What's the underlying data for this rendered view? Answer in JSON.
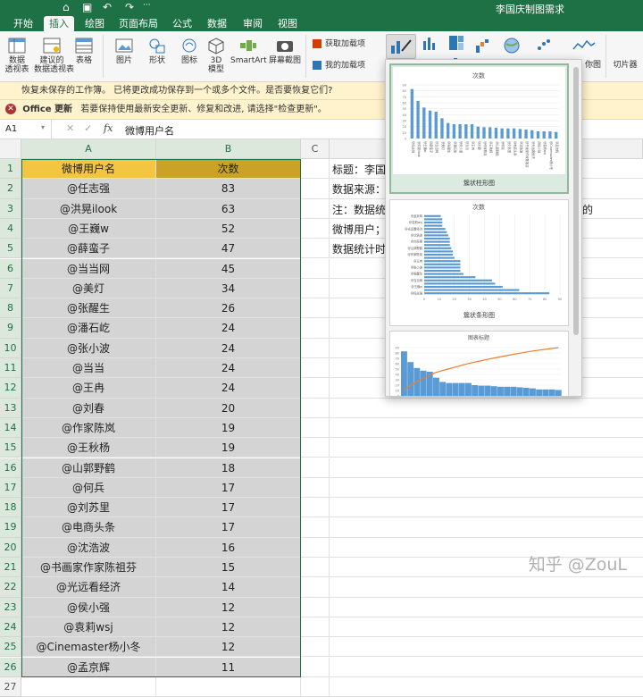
{
  "window": {
    "title": "李国庆制图需求"
  },
  "tabs": [
    "开始",
    "插入",
    "绘图",
    "页面布局",
    "公式",
    "数据",
    "审阅",
    "视图"
  ],
  "ribbon": {
    "pivot_table": "数据\n透视表",
    "recommended_pivot": "建议的\n数据透视表",
    "table": "表格",
    "pictures": "图片",
    "shapes": "形状",
    "icons": "图标",
    "model_3d": "3D\n模型",
    "smartart": "SmartArt",
    "screenshot": "屏幕截图",
    "get_addins": "获取加载项",
    "my_addins": "我的加载项",
    "map": "你图",
    "slicer": "切片器"
  },
  "messages": {
    "unsaved": "恢复未保存的工作簿。 已将更改成功保存到一个或多个文件。是否要恢复它们?",
    "update_label": "Office 更新",
    "update_text": "若要保持使用最新安全更新、修复和改进, 请选择\"检查更新\"。"
  },
  "formula_bar": {
    "name_box": "A1",
    "fx": "fx",
    "content": "微博用户名"
  },
  "columns": [
    "A",
    "B",
    "C"
  ],
  "headers": {
    "user": "微博用户名",
    "count": "次数"
  },
  "rows": [
    {
      "user": "@任志强",
      "count": "83"
    },
    {
      "user": "@洪晃ilook",
      "count": "63"
    },
    {
      "user": "@王巍w",
      "count": "52"
    },
    {
      "user": "@薛蛮子",
      "count": "47"
    },
    {
      "user": "@当当网",
      "count": "45"
    },
    {
      "user": "@美灯",
      "count": "34"
    },
    {
      "user": "@张醒生",
      "count": "26"
    },
    {
      "user": "@潘石屹",
      "count": "24"
    },
    {
      "user": "@张小波",
      "count": "24"
    },
    {
      "user": "@当当",
      "count": "24"
    },
    {
      "user": "@王冉",
      "count": "24"
    },
    {
      "user": "@刘春",
      "count": "20"
    },
    {
      "user": "@作家陈岚",
      "count": "19"
    },
    {
      "user": "@王秋杨",
      "count": "19"
    },
    {
      "user": "@山郭野鹤",
      "count": "18"
    },
    {
      "user": "@何兵",
      "count": "17"
    },
    {
      "user": "@刘苏里",
      "count": "17"
    },
    {
      "user": "@电商头条",
      "count": "17"
    },
    {
      "user": "@沈浩波",
      "count": "16"
    },
    {
      "user": "@书画家作家陈祖芬",
      "count": "15"
    },
    {
      "user": "@光远看经济",
      "count": "14"
    },
    {
      "user": "@侯小强",
      "count": "12"
    },
    {
      "user": "@袁莉wsj",
      "count": "12"
    },
    {
      "user": "@Cinemaster杨小冬",
      "count": "12"
    },
    {
      "user": "@孟京辉",
      "count": "11"
    }
  ],
  "side_notes": [
    "标题：李国",
    "数据来源：",
    "注：数据统",
    "微博用户；",
    "数据统计时"
  ],
  "side_note_extra": "的",
  "chart_gallery": {
    "thumb1": {
      "title": "次数",
      "label": "簇状柱形图"
    },
    "thumb2": {
      "title": "次数",
      "label": "簇状条形图"
    },
    "thumb3": {
      "title": "图表标题"
    }
  },
  "chart_data": {
    "type": "bar",
    "categories": [
      "@任志强",
      "@洪晃ilook",
      "@王巍w",
      "@薛蛮子",
      "@当当网",
      "@美灯",
      "@张醒生",
      "@潘石屹",
      "@张小波",
      "@当当",
      "@王冉",
      "@刘春",
      "@作家陈岚",
      "@王秋杨",
      "@山郭野鹤",
      "@何兵",
      "@刘苏里",
      "@电商头条",
      "@沈浩波",
      "@书画家作家陈祖芬",
      "@光远看经济",
      "@侯小强",
      "@袁莉wsj",
      "@Cinemaster杨小冬",
      "@孟京辉"
    ],
    "values": [
      83,
      63,
      52,
      47,
      45,
      34,
      26,
      24,
      24,
      24,
      24,
      20,
      19,
      19,
      18,
      17,
      17,
      17,
      16,
      15,
      14,
      12,
      12,
      12,
      11
    ],
    "title": "次数",
    "ylim": [
      0,
      90
    ]
  },
  "colors": {
    "excel_green": "#1e7145",
    "header_fill": "#f4c542",
    "count_header_fill": "#c9a227",
    "bar": "#5b9bd5",
    "line": "#ed7d31"
  },
  "watermark": "知乎 @ZouL"
}
